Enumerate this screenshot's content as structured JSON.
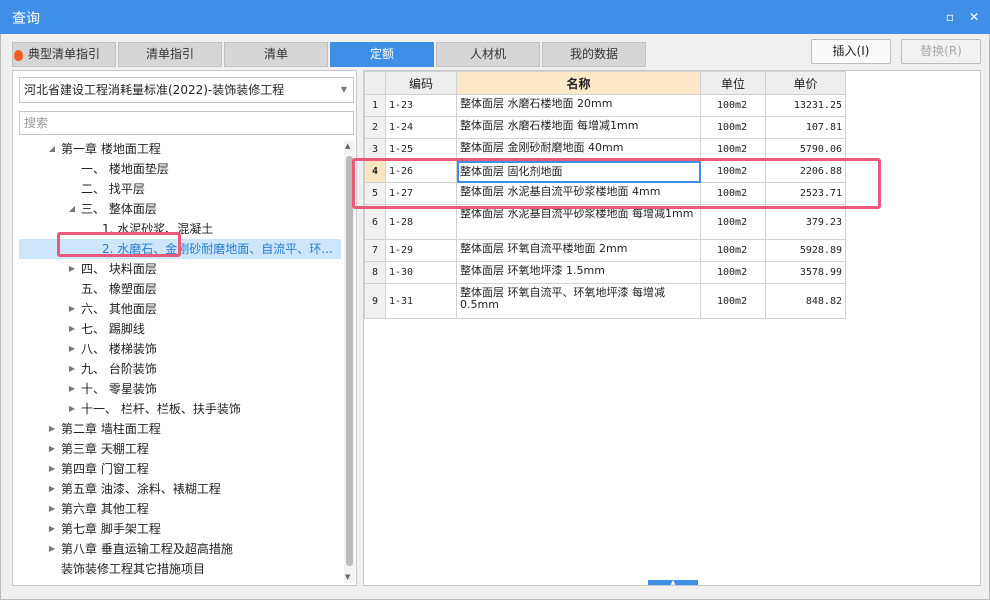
{
  "window": {
    "title": "查询",
    "restore_glyph": "▫",
    "close_glyph": "✕"
  },
  "tabs": [
    {
      "label": "典型清单指引"
    },
    {
      "label": "清单指引"
    },
    {
      "label": "清单"
    },
    {
      "label": "定额"
    },
    {
      "label": "人材机"
    },
    {
      "label": "我的数据"
    }
  ],
  "active_tab": "定额",
  "actions": {
    "insert_label": "插入(I)",
    "replace_label": "替换(R)"
  },
  "left": {
    "standard_select": "河北省建设工程消耗量标准(2022)-装饰装修工程",
    "search_placeholder": "搜索",
    "tree": [
      {
        "label": "第一章 楼地面工程",
        "arrow": "◢"
      },
      {
        "label": "一、 楼地面垫层",
        "arrow": ""
      },
      {
        "label": "二、 找平层",
        "arrow": ""
      },
      {
        "label": "三、 整体面层",
        "arrow": "◢"
      },
      {
        "label": "1. 水泥砂浆、混凝土",
        "arrow": ""
      },
      {
        "label": "2. 水磨石、金刚砂耐磨地面、自流平、环...",
        "arrow": ""
      },
      {
        "label": "四、 块料面层",
        "arrow": "▶"
      },
      {
        "label": "五、 橡塑面层",
        "arrow": ""
      },
      {
        "label": "六、 其他面层",
        "arrow": "▶"
      },
      {
        "label": "七、 踢脚线",
        "arrow": "▶"
      },
      {
        "label": "八、 楼梯装饰",
        "arrow": "▶"
      },
      {
        "label": "九、 台阶装饰",
        "arrow": "▶"
      },
      {
        "label": "十、 零星装饰",
        "arrow": "▶"
      },
      {
        "label": "十一、 栏杆、栏板、扶手装饰",
        "arrow": "▶"
      },
      {
        "label": "第二章 墙柱面工程",
        "arrow": "▶"
      },
      {
        "label": "第三章 天棚工程",
        "arrow": "▶"
      },
      {
        "label": "第四章 门窗工程",
        "arrow": "▶"
      },
      {
        "label": "第五章 油漆、涂料、裱糊工程",
        "arrow": "▶"
      },
      {
        "label": "第六章 其他工程",
        "arrow": "▶"
      },
      {
        "label": "第七章 脚手架工程",
        "arrow": "▶"
      },
      {
        "label": "第八章 垂直运输工程及超高措施",
        "arrow": "▶"
      },
      {
        "label": "装饰装修工程其它措施项目",
        "arrow": ""
      }
    ],
    "selected_index": 5
  },
  "grid": {
    "columns": {
      "code": "编码",
      "name": "名称",
      "unit": "单位",
      "price": "单价"
    },
    "rows": [
      {
        "n": "1",
        "code": "1-23",
        "name": "整体面层 水磨石楼地面 20mm",
        "unit": "100m2",
        "price": "13231.25"
      },
      {
        "n": "2",
        "code": "1-24",
        "name": "整体面层 水磨石楼地面 每增减1mm",
        "unit": "100m2",
        "price": "107.81"
      },
      {
        "n": "3",
        "code": "1-25",
        "name": "整体面层 金刚砂耐磨地面 40mm",
        "unit": "100m2",
        "price": "5790.06"
      },
      {
        "n": "4",
        "code": "1-26",
        "name": "整体面层 固化剂地面",
        "unit": "100m2",
        "price": "2206.88"
      },
      {
        "n": "5",
        "code": "1-27",
        "name": "整体面层 水泥基自流平砂浆楼地面 4mm",
        "unit": "100m2",
        "price": "2523.71"
      },
      {
        "n": "6",
        "code": "1-28",
        "name": "整体面层 水泥基自流平砂浆楼地面 每增减1mm",
        "unit": "100m2",
        "price": "379.23"
      },
      {
        "n": "7",
        "code": "1-29",
        "name": "整体面层 环氧自流平楼地面 2mm",
        "unit": "100m2",
        "price": "5928.89"
      },
      {
        "n": "8",
        "code": "1-30",
        "name": "整体面层 环氧地坪漆 1.5mm",
        "unit": "100m2",
        "price": "3578.99"
      },
      {
        "n": "9",
        "code": "1-31",
        "name": "整体面层 环氧自流平、环氧地坪漆 每增减0.5mm",
        "unit": "100m2",
        "price": "848.82"
      }
    ],
    "current_row": 3
  },
  "colors": {
    "accent": "#3f8fe6",
    "highlight": "#e8597a",
    "tree_selected_bg": "#cde6fb"
  }
}
